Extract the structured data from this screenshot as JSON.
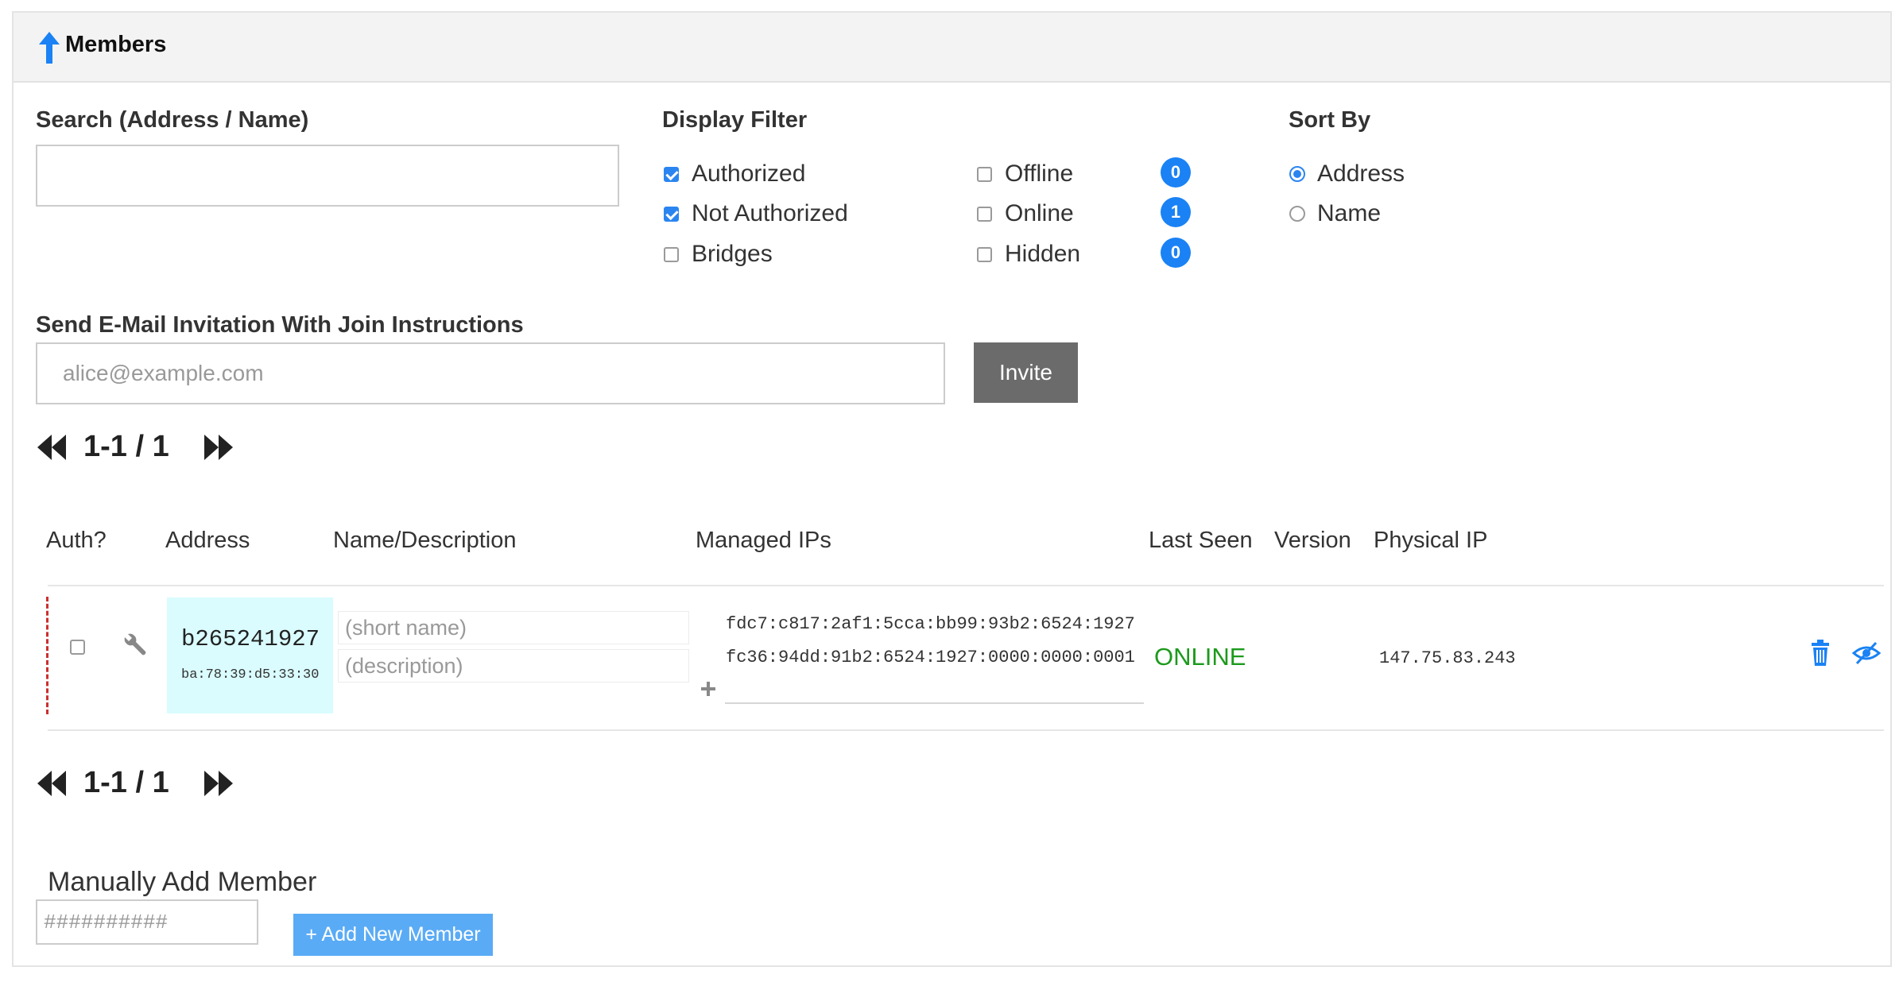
{
  "header": {
    "title": "Members",
    "icon": "arrow-up-icon"
  },
  "search": {
    "label": "Search (Address / Name)",
    "value": "",
    "placeholder": ""
  },
  "display_filter": {
    "label": "Display Filter",
    "options": [
      {
        "label": "Authorized",
        "checked": true
      },
      {
        "label": "Not Authorized",
        "checked": true
      },
      {
        "label": "Bridges",
        "checked": false
      },
      {
        "label": "Offline",
        "checked": false,
        "count": "0"
      },
      {
        "label": "Online",
        "checked": false,
        "count": "1"
      },
      {
        "label": "Hidden",
        "checked": false,
        "count": "0"
      }
    ]
  },
  "sort_by": {
    "label": "Sort By",
    "options": [
      {
        "label": "Address",
        "selected": true
      },
      {
        "label": "Name",
        "selected": false
      }
    ]
  },
  "invite": {
    "label": "Send E-Mail Invitation With Join Instructions",
    "placeholder": "alice@example.com",
    "button_label": "Invite"
  },
  "pagination": {
    "text": "1-1 / 1"
  },
  "table": {
    "columns": [
      "Auth?",
      "Address",
      "Name/Description",
      "Managed IPs",
      "Last Seen",
      "Version",
      "Physical IP"
    ],
    "rows": [
      {
        "authorized": false,
        "address": "b265241927",
        "mac": "ba:78:39:d5:33:30",
        "name_placeholder": "(short name)",
        "description_placeholder": "(description)",
        "managed_ips": [
          "fdc7:c817:2af1:5cca:bb99:93b2:6524:1927",
          "fc36:94dd:91b2:6524:1927:0000:0000:0001"
        ],
        "last_seen": "ONLINE",
        "version": "",
        "physical_ip": "147.75.83.243"
      }
    ]
  },
  "manual_add": {
    "title": "Manually Add Member",
    "placeholder": "##########",
    "button_label": "+ Add New Member"
  },
  "colors": {
    "accent": "#1a82f4",
    "online": "#1c9a1c",
    "invite_button": "#6b6b6b",
    "add_button": "#5aabf5",
    "address_cell": "#dafcfe"
  }
}
